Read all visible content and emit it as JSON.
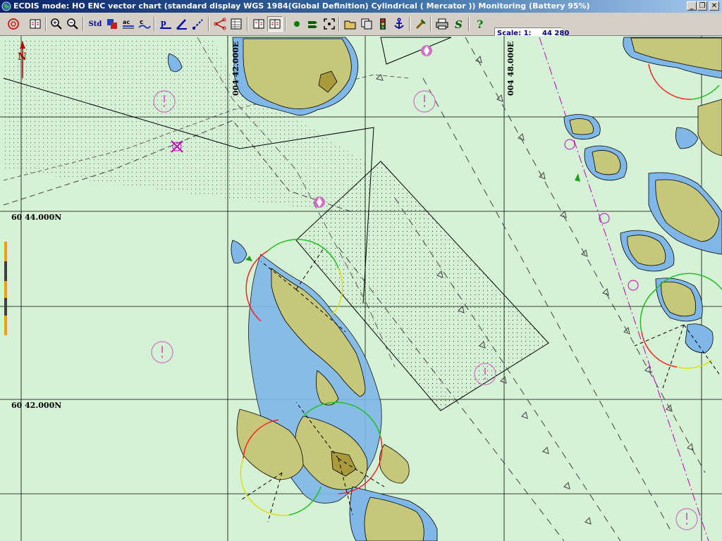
{
  "window": {
    "title": "ECDIS mode: HO ENC vector chart (standard display  WGS 1984(Global Definition)  Cylindrical ( Mercator )) Monitoring  (Battery  95%)",
    "controls": {
      "minimize": "_",
      "restore": "❐",
      "close": "✕"
    }
  },
  "toolbar": {
    "std_label": "Std",
    "buttons": [
      "target-icon",
      "chart-book-icon",
      "zoom-in-icon",
      "zoom-out-icon",
      "std-display-button",
      "layers-icon",
      "text-labels-icon",
      "depth-contour-icon",
      "planning-icon",
      "route-edit-icon",
      "route-check-icon",
      "route-icon",
      "table-icon",
      "chart-folio-icon",
      "chart-folio-active-icon",
      "position-icon",
      "current-icon",
      "fit-icon",
      "open-folder-icon",
      "copy-icon",
      "traffic-light-icon",
      "anchor-icon",
      "tools-icon",
      "print-icon",
      "script-icon",
      "help-icon"
    ],
    "scale_label": "Scale: 1:",
    "scale_value": "44 280"
  },
  "chart": {
    "lat_labels": [
      "60 44.000N",
      "60 42.000N"
    ],
    "lon_labels": [
      "004 42.000E",
      "004 48.000E"
    ],
    "north_label": "N",
    "colors": {
      "sea": "#d6f2d6",
      "shallow": "#7fb7e8",
      "land": "#c7c77a",
      "land_dark": "#a99a3c",
      "magenta": "#c000c0",
      "sector_red": "#ff2020",
      "sector_green": "#20c020",
      "sector_yellow": "#e0e000"
    }
  }
}
